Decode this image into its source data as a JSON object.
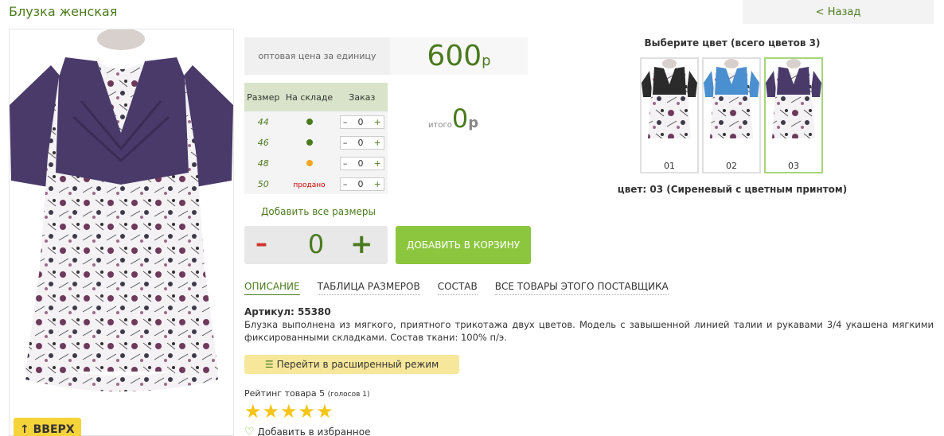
{
  "page": {
    "title": "Блузка женская",
    "back_label": "< Назад"
  },
  "price": {
    "label": "оптовая цена за единицу",
    "value": "600",
    "currency": "р"
  },
  "size_table": {
    "headers": [
      "Размер",
      "На складе",
      "Заказ"
    ],
    "rows": [
      {
        "size": "44",
        "stock": "green",
        "stock_text": "",
        "qty": "0"
      },
      {
        "size": "46",
        "stock": "green",
        "stock_text": "",
        "qty": "0"
      },
      {
        "size": "48",
        "stock": "orange",
        "stock_text": "",
        "qty": "0"
      },
      {
        "size": "50",
        "stock": "sold",
        "stock_text": "продано",
        "qty": "0"
      }
    ],
    "minus": "–",
    "plus": "+"
  },
  "total": {
    "label": "итого",
    "value": "0",
    "currency": "р"
  },
  "add_all_sizes": "Добавить все размеры",
  "quantity": {
    "minus": "–",
    "value": "0",
    "plus": "+"
  },
  "add_to_cart": "ДОБАВИТЬ В КОРЗИНУ",
  "tabs": [
    {
      "label": "ОПИСАНИЕ",
      "active": true
    },
    {
      "label": "ТАБЛИЦА РАЗМЕРОВ",
      "active": false
    },
    {
      "label": "СОСТАВ",
      "active": false
    },
    {
      "label": "ВСЕ ТОВАРЫ ЭТОГО ПОСТАВЩИКА",
      "active": false
    }
  ],
  "description": {
    "article": "Артикул: 55380",
    "text": "Блузка выполнена из мягкого, приятного трикотажа двух цветов. Модель с завышенной линией талии и рукавами 3/4 укашена мягкими фиксированными складками. Состав ткани: 100% п/э."
  },
  "extended_mode": "Перейти в расширенный режим",
  "rating": {
    "text": "Рейтинг товара 5",
    "votes": "(голосов 1)",
    "stars": 5
  },
  "favorite": "Добавить в избранное",
  "top_button": "ВВЕРХ",
  "colors": {
    "title": "Выберите цвет (всего цветов 3)",
    "swatches": [
      {
        "label": "01",
        "yoke": "#2b2b2b"
      },
      {
        "label": "02",
        "yoke": "#4a8fd0"
      },
      {
        "label": "03",
        "yoke": "#4a3a6a"
      }
    ],
    "selected": "цвет: 03 (Сиреневый с цветным принтом)"
  },
  "colors_palette": {
    "accent": "#4a7a1e",
    "cart_green": "#8cc63f",
    "star": "#f5c518",
    "minus_red": "#d0332b",
    "blouse_purple": "#4a3a6a"
  }
}
